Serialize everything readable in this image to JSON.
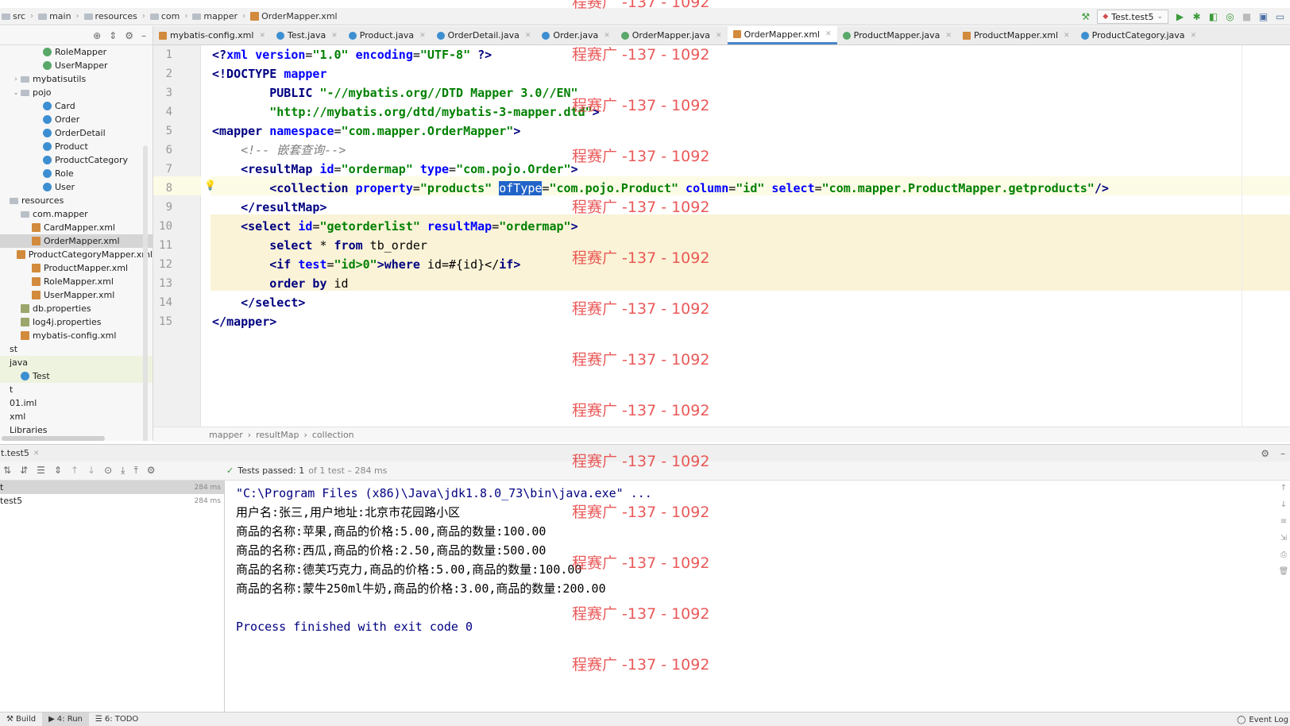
{
  "breadcrumb": [
    "src",
    "main",
    "resources",
    "com",
    "mapper",
    "OrderMapper.xml"
  ],
  "run_config": {
    "label": "Test.test5"
  },
  "project": {
    "items": [
      {
        "label": "RoleMapper",
        "icon": "interface-icon",
        "indent": 3
      },
      {
        "label": "UserMapper",
        "icon": "interface-icon",
        "indent": 3
      },
      {
        "label": "mybatisutils",
        "icon": "folder-icon",
        "indent": 1,
        "arrow": "›"
      },
      {
        "label": "pojo",
        "icon": "folder-icon",
        "indent": 1,
        "arrow": "⌄"
      },
      {
        "label": "Card",
        "icon": "class-icon",
        "indent": 3
      },
      {
        "label": "Order",
        "icon": "class-icon",
        "indent": 3
      },
      {
        "label": "OrderDetail",
        "icon": "class-icon",
        "indent": 3
      },
      {
        "label": "Product",
        "icon": "class-icon",
        "indent": 3
      },
      {
        "label": "ProductCategory",
        "icon": "class-icon",
        "indent": 3
      },
      {
        "label": "Role",
        "icon": "class-icon",
        "indent": 3
      },
      {
        "label": "User",
        "icon": "class-icon",
        "indent": 3
      },
      {
        "label": "resources",
        "icon": "folder-icon",
        "indent": 0
      },
      {
        "label": "com.mapper",
        "icon": "folder-icon",
        "indent": 1
      },
      {
        "label": "CardMapper.xml",
        "icon": "xml-icon",
        "indent": 2
      },
      {
        "label": "OrderMapper.xml",
        "icon": "xml-icon",
        "indent": 2,
        "selected": true
      },
      {
        "label": "ProductCategoryMapper.xml",
        "icon": "xml-icon",
        "indent": 2
      },
      {
        "label": "ProductMapper.xml",
        "icon": "xml-icon",
        "indent": 2
      },
      {
        "label": "RoleMapper.xml",
        "icon": "xml-icon",
        "indent": 2
      },
      {
        "label": "UserMapper.xml",
        "icon": "xml-icon",
        "indent": 2
      },
      {
        "label": "db.properties",
        "icon": "properties-icon",
        "indent": 1
      },
      {
        "label": "log4j.properties",
        "icon": "properties-icon",
        "indent": 1
      },
      {
        "label": "mybatis-config.xml",
        "icon": "xml-icon",
        "indent": 1
      },
      {
        "label": "st",
        "icon": "",
        "indent": 0
      },
      {
        "label": "java",
        "icon": "",
        "indent": 0,
        "highlight": true
      },
      {
        "label": "Test",
        "icon": "class-icon",
        "indent": 1,
        "highlight": true
      },
      {
        "label": "t",
        "icon": "",
        "indent": 0
      },
      {
        "label": "01.iml",
        "icon": "",
        "indent": 0
      },
      {
        "label": "xml",
        "icon": "",
        "indent": 0
      },
      {
        "label": "Libraries",
        "icon": "",
        "indent": 0
      }
    ]
  },
  "tabs": [
    {
      "label": "mybatis-config.xml",
      "icon": "xml-icon"
    },
    {
      "label": "Test.java",
      "icon": "class-icon"
    },
    {
      "label": "Product.java",
      "icon": "class-icon"
    },
    {
      "label": "OrderDetail.java",
      "icon": "class-icon"
    },
    {
      "label": "Order.java",
      "icon": "class-icon"
    },
    {
      "label": "OrderMapper.java",
      "icon": "interface-icon"
    },
    {
      "label": "OrderMapper.xml",
      "icon": "xml-icon",
      "active": true
    },
    {
      "label": "ProductMapper.java",
      "icon": "interface-icon"
    },
    {
      "label": "ProductMapper.xml",
      "icon": "xml-icon"
    },
    {
      "label": "ProductCategory.java",
      "icon": "class-icon"
    }
  ],
  "editor": {
    "lines": [
      "1",
      "2",
      "3",
      "4",
      "5",
      "6",
      "7",
      "8",
      "9",
      "10",
      "11",
      "12",
      "13",
      "14",
      "15"
    ],
    "code": {
      "l1_a": "<?",
      "l1_b": "xml ",
      "l1_c": "version",
      "l1_d": "=",
      "l1_e": "\"1.0\"",
      "l1_f": " encoding",
      "l1_g": "=",
      "l1_h": "\"UTF-8\"",
      "l1_i": " ?>",
      "l2_a": "<!DOCTYPE ",
      "l2_b": "mapper",
      "l3_a": "        PUBLIC ",
      "l3_b": "\"-//mybatis.org//DTD Mapper 3.0//EN\"",
      "l4_a": "        ",
      "l4_b": "\"http://mybatis.org/dtd/mybatis-3-mapper.dtd\"",
      "l4_c": ">",
      "l5_a": "<",
      "l5_b": "mapper ",
      "l5_c": "namespace",
      "l5_d": "=",
      "l5_e": "\"com.mapper.OrderMapper\"",
      "l5_f": ">",
      "l6": "    <!-- 嵌套查询-->",
      "l7_a": "    <",
      "l7_b": "resultMap ",
      "l7_c": "id",
      "l7_d": "=",
      "l7_e": "\"ordermap\"",
      "l7_f": " type",
      "l7_g": "=",
      "l7_h": "\"com.pojo.Order\"",
      "l7_i": ">",
      "l8_a": "        <",
      "l8_b": "collection ",
      "l8_c": "property",
      "l8_d": "=",
      "l8_e": "\"products\"",
      "l8_f": " ",
      "l8_g": "ofType",
      "l8_h": "=",
      "l8_i": "\"com.pojo.Product\"",
      "l8_j": " column",
      "l8_k": "=",
      "l8_l": "\"id\"",
      "l8_m": " select",
      "l8_n": "=",
      "l8_o": "\"com.mapper.ProductMapper.getproducts\"",
      "l8_p": "/>",
      "l9_a": "    </",
      "l9_b": "resultMap",
      "l9_c": ">",
      "l10_a": "    <",
      "l10_b": "select ",
      "l10_c": "id",
      "l10_d": "=",
      "l10_e": "\"getorderlist\"",
      "l10_f": " resultMap",
      "l10_g": "=",
      "l10_h": "\"ordermap\"",
      "l10_i": ">",
      "l11_a": "        ",
      "l11_b": "select",
      "l11_c": " * ",
      "l11_d": "from",
      "l11_e": " tb_order",
      "l12_a": "        <",
      "l12_b": "if ",
      "l12_c": "test",
      "l12_d": "=",
      "l12_e": "\"id>0\"",
      "l12_f": ">",
      "l12_g": "where",
      "l12_h": " id=#{id}</",
      "l12_i": "if",
      "l12_j": ">",
      "l13_a": "        ",
      "l13_b": "order by",
      "l13_c": " id",
      "l14_a": "    </",
      "l14_b": "select",
      "l14_c": ">",
      "l15_a": "</",
      "l15_b": "mapper",
      "l15_c": ">"
    }
  },
  "editor_breadcrumb": [
    "mapper",
    "resultMap",
    "collection"
  ],
  "run": {
    "tab_label": "t.test5",
    "status": "Tests passed: 1",
    "status_detail": "of 1 test – 284 ms",
    "tree": [
      {
        "label": "t",
        "time": "284 ms",
        "selected": true
      },
      {
        "label": "test5",
        "time": "284 ms"
      }
    ],
    "console": [
      "\"C:\\Program Files (x86)\\Java\\jdk1.8.0_73\\bin\\java.exe\" ...",
      "用户名:张三,用户地址:北京市花园路小区",
      "商品的名称:苹果,商品的价格:5.00,商品的数量:100.00",
      "商品的名称:西瓜,商品的价格:2.50,商品的数量:500.00",
      "商品的名称:德芙巧克力,商品的价格:5.00,商品的数量:100.00",
      "商品的名称:蒙牛250ml牛奶,商品的价格:3.00,商品的数量:200.00",
      "",
      "Process finished with exit code 0"
    ]
  },
  "bottom": {
    "build": "Build",
    "run": "4: Run",
    "todo": "6: TODO",
    "event_log": "Event Log"
  },
  "watermark": "程赛广 -137 - 1092",
  "colors": {
    "accent": "#4a86c8",
    "highlight_block": "#faf3d7",
    "selection": "#2163c8",
    "watermark": "#e63c3c",
    "pass": "#3a9a3a"
  }
}
